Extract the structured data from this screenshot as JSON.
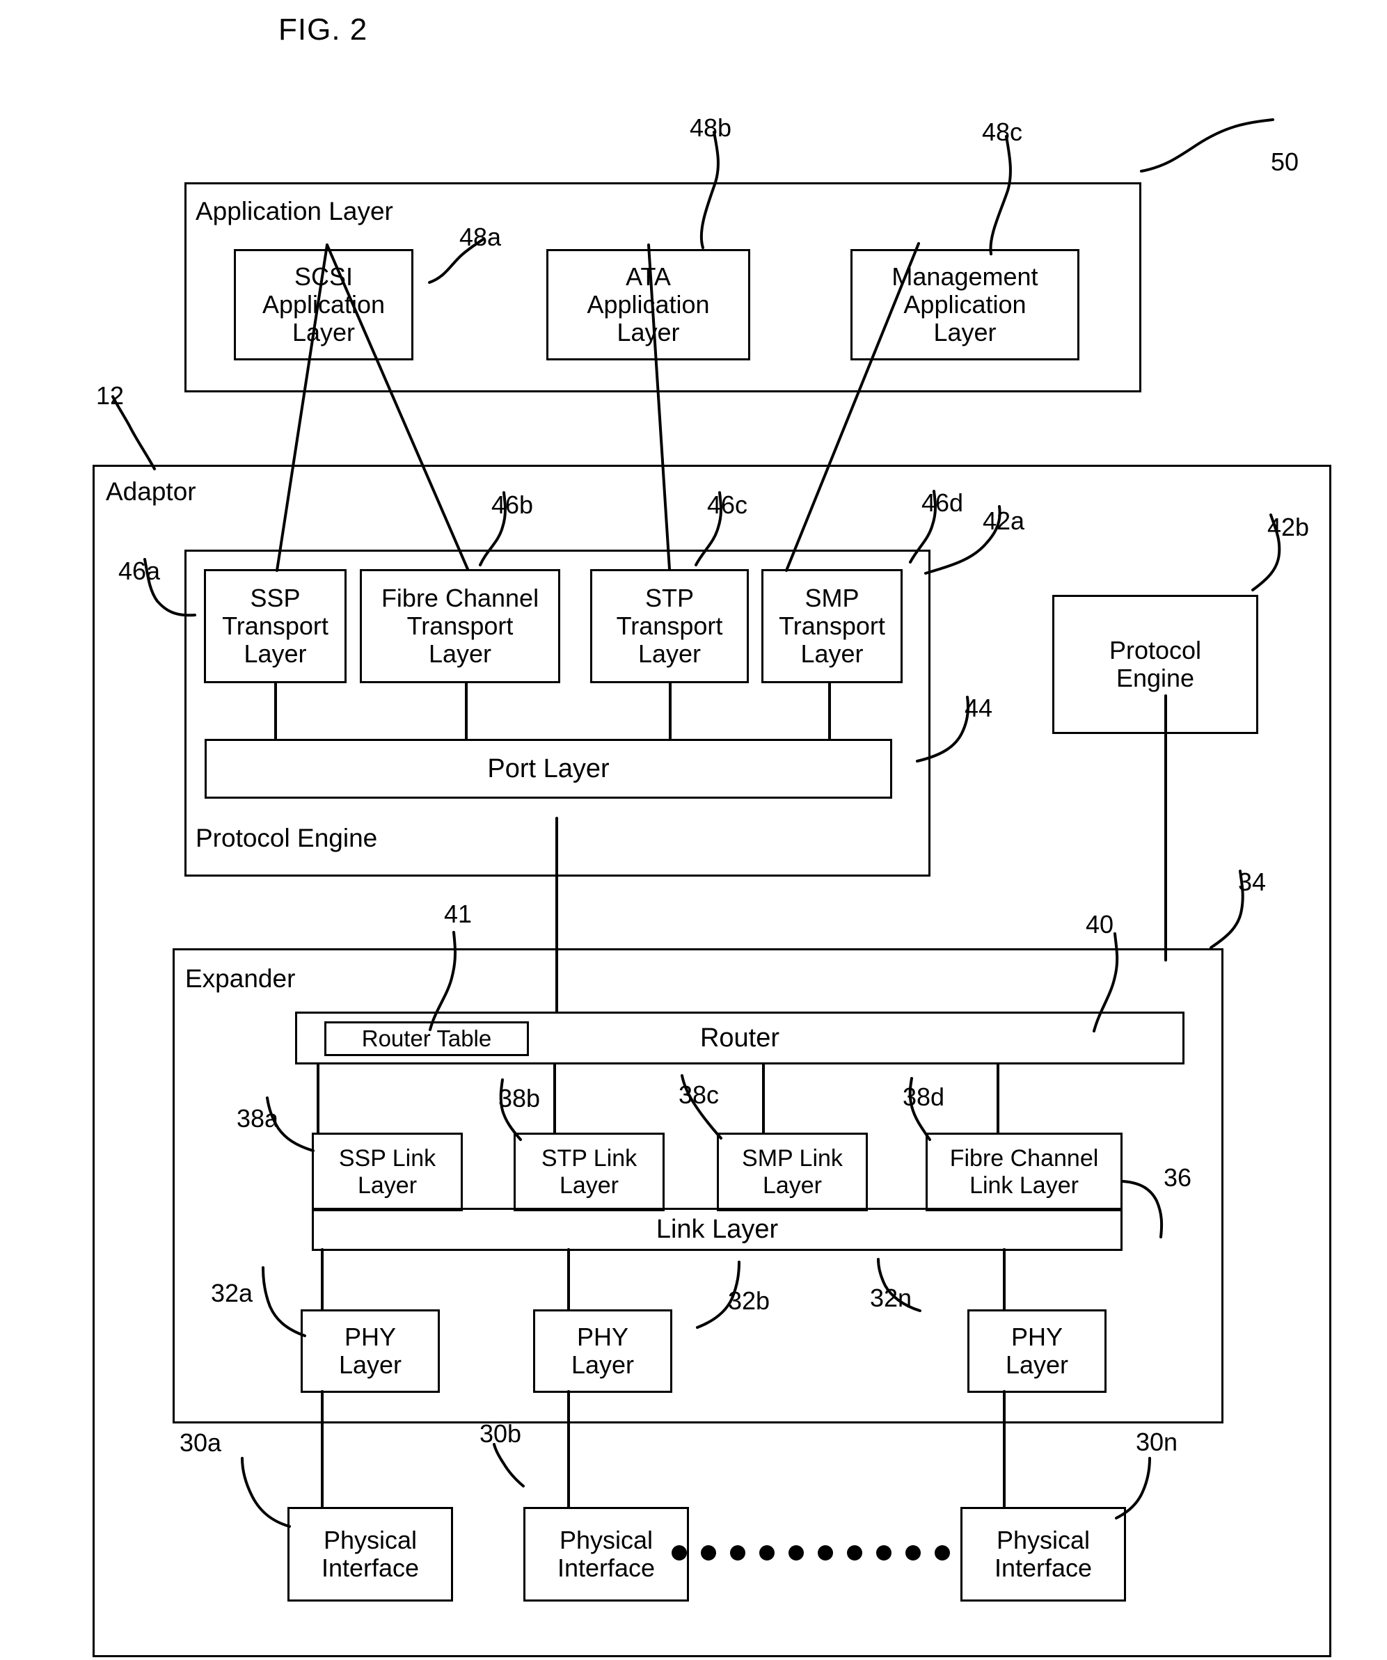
{
  "figure": {
    "title": "FIG. 2"
  },
  "application_layer": {
    "caption": "Application Layer",
    "ref": "50",
    "boxes": [
      {
        "label": "SCSI\nApplication\nLayer",
        "ref": "48a"
      },
      {
        "label": "ATA\nApplication\nLayer",
        "ref": "48b"
      },
      {
        "label": "Management\nApplication\nLayer",
        "ref": "48c"
      }
    ]
  },
  "adaptor": {
    "caption": "Adaptor",
    "ref": "12",
    "protocol_engine": {
      "caption": "Protocol Engine",
      "ref": "42a",
      "transport_layers": [
        {
          "label": "SSP\nTransport\nLayer",
          "ref": "46a"
        },
        {
          "label": "Fibre Channel\nTransport\nLayer",
          "ref": "46b"
        },
        {
          "label": "STP\nTransport\nLayer",
          "ref": "46c"
        },
        {
          "label": "SMP\nTransport\nLayer",
          "ref": "46d"
        }
      ],
      "port_layer": {
        "label": "Port Layer",
        "ref": "44"
      }
    },
    "protocol_engine_right": {
      "label": "Protocol\nEngine",
      "ref": "42b"
    },
    "expander": {
      "caption": "Expander",
      "ref": "34",
      "router": {
        "label": "Router",
        "ref": "40"
      },
      "router_table": {
        "label": "Router Table",
        "ref": "41"
      },
      "link_layers": [
        {
          "label": "SSP Link\nLayer",
          "ref": "38a"
        },
        {
          "label": "STP Link\nLayer",
          "ref": "38b"
        },
        {
          "label": "SMP Link\nLayer",
          "ref": "38c"
        },
        {
          "label": "Fibre Channel\nLink Layer",
          "ref": "38d"
        }
      ],
      "link_layer": {
        "label": "Link Layer",
        "ref": "36"
      },
      "phy_layers": [
        {
          "label": "PHY\nLayer",
          "ref": "32a"
        },
        {
          "label": "PHY\nLayer",
          "ref": "32b"
        },
        {
          "label": "PHY\nLayer",
          "ref": "32n"
        }
      ]
    },
    "physical_interfaces": [
      {
        "label": "Physical\nInterface",
        "ref": "30a"
      },
      {
        "label": "Physical\nInterface",
        "ref": "30b"
      },
      {
        "label": "Physical\nInterface",
        "ref": "30n"
      }
    ]
  }
}
